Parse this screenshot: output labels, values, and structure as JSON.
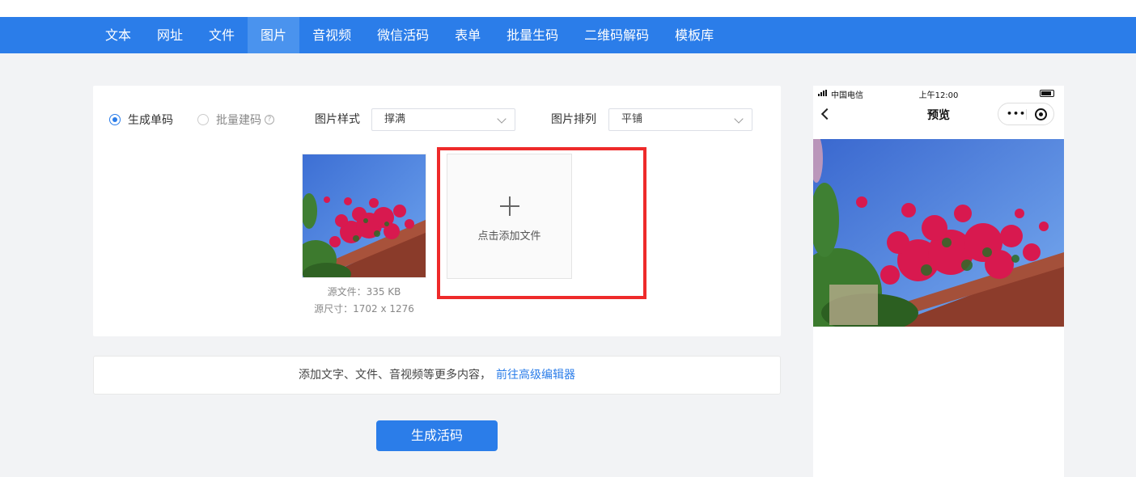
{
  "nav": {
    "tabs": [
      "文本",
      "网址",
      "文件",
      "图片",
      "音视频",
      "微信活码",
      "表单",
      "批量生码",
      "二维码解码",
      "模板库"
    ],
    "active": "图片"
  },
  "mode": {
    "single_label": "生成单码",
    "batch_label": "批量建码",
    "selected": "single"
  },
  "options": {
    "style_label": "图片样式",
    "style_value": "撑满",
    "arrange_label": "图片排列",
    "arrange_value": "平铺"
  },
  "file": {
    "size_text": "源文件：335 KB",
    "dims_text": "源尺寸：1702 x 1276"
  },
  "upload": {
    "label": "点击添加文件"
  },
  "info_bar": {
    "text": "添加文字、文件、音视频等更多内容，",
    "link": "前往高级编辑器"
  },
  "generate_button": "生成活码",
  "phone": {
    "carrier": "中国电信",
    "time": "上午12:00",
    "title": "预览",
    "menu_dots": "•••"
  },
  "colors": {
    "accent": "#2b7de9",
    "highlight": "#ee2a2a"
  }
}
